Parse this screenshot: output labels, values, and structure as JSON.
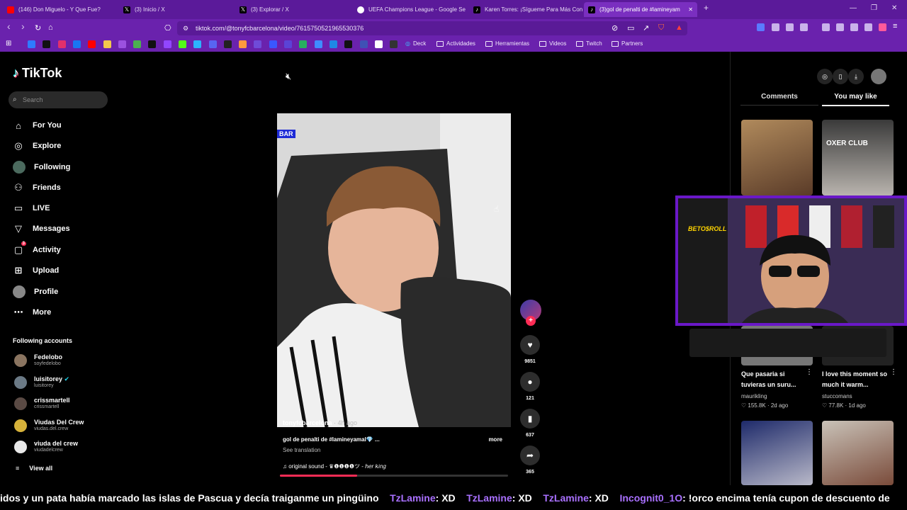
{
  "browser": {
    "tabs": [
      {
        "title": "(146) Don Miguelo - Y Que Fue?",
        "color": "#ff0000"
      },
      {
        "title": "(3) Inicio / X",
        "color": "#000000"
      },
      {
        "title": "(3) Explorar / X",
        "color": "#000000"
      },
      {
        "title": "UEFA Champions League - Google Se",
        "color": "#ffffff"
      },
      {
        "title": "Karen Torres: ¡Sígueme Para Más Con",
        "color": "#000000"
      },
      {
        "title": "(3)gol de penalti de #lamineyam",
        "color": "#000000"
      }
    ],
    "url": "tiktok.com/@tonyfcbarcelona/video/7615750521965530376",
    "bookmarks": [
      "Deck",
      "Actividades",
      "Herramientas",
      "Videos",
      "Twitch",
      "Partners"
    ],
    "new_tab": "+",
    "close_tab": "✕",
    "win_minimize": "—",
    "win_restore": "❐",
    "win_close": "✕",
    "back": "‹",
    "forward": "›",
    "reload": "↻",
    "home": "⌂"
  },
  "tiktok": {
    "logo": "TikTok",
    "search_placeholder": "Search",
    "nav": [
      {
        "label": "For You",
        "icon": "⌂"
      },
      {
        "label": "Explore",
        "icon": "◎"
      },
      {
        "label": "Following",
        "icon": ""
      },
      {
        "label": "Friends",
        "icon": "⚇"
      },
      {
        "label": "LIVE",
        "icon": "▭"
      },
      {
        "label": "Messages",
        "icon": "▽"
      },
      {
        "label": "Activity",
        "icon": "▢",
        "badge": "3"
      },
      {
        "label": "Upload",
        "icon": "⊞"
      },
      {
        "label": "Profile",
        "icon": ""
      },
      {
        "label": "More",
        "icon": "⋯"
      }
    ],
    "following_title": "Following accounts",
    "accounts": [
      {
        "name": "Fedelobo",
        "handle": "soyfedelobo"
      },
      {
        "name": "luisitorey",
        "handle": "luisitorey"
      },
      {
        "name": "crissmartell",
        "handle": "crissmartell"
      },
      {
        "name": "Viudas Del Crew",
        "handle": "viudas.del.crew"
      },
      {
        "name": "viuda del crew",
        "handle": "viudadelcrew"
      }
    ],
    "view_all": "View all",
    "video": {
      "overlay_label": "BAR",
      "author": "tonyfcbarcelona",
      "time": " · 4h ago",
      "caption": "gol de penalti de #lamineyamal💎 ...",
      "more": "more",
      "see_translation": "See translation",
      "sound": "♫  original sound - ♛❶❶❶❶ツ - ℎ𝑒𝑟 𝑘𝑖𝑛𝑔",
      "progress": 0.34
    },
    "actions": {
      "likes": "9851",
      "comments": "121",
      "saves": "637",
      "shares": "365"
    },
    "panel_tabs": {
      "comments": "Comments",
      "you_may_like": "You may like"
    },
    "suggested": [
      {
        "title": "Que pasaria si tuvieras un suru...",
        "user": "maurikling",
        "meta": "♡ 155.8K · 2d ago"
      },
      {
        "title": "I love this moment so much it warm...",
        "user": "stuccomans",
        "meta": "♡ 77.8K · 1d ago"
      }
    ],
    "thumb2_text": "OXER CLUB"
  },
  "stream": {
    "chat": [
      {
        "user": "",
        "text": "idos y un pata había marcado las islas de Pascua y decía traiganme un pingüino"
      },
      {
        "user": "TzLamine",
        "text": ": XD"
      },
      {
        "user": "TzLamine",
        "text": ": XD"
      },
      {
        "user": "TzLamine",
        "text": ": XD"
      },
      {
        "user": "Incognit0_1O",
        "text": ": !orco encima tenía cupon de descuento de"
      }
    ],
    "webcam_sign": "BETO$ROLL"
  }
}
